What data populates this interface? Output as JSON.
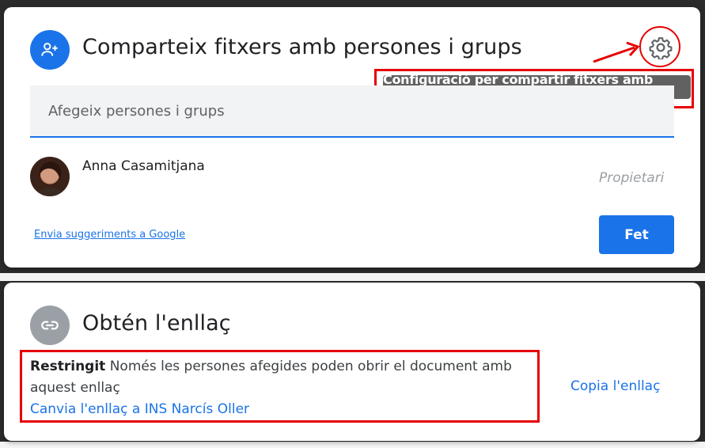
{
  "share_dialog": {
    "title": "Comparteix fitxers amb persones i grups",
    "settings_tooltip": "Configuració per compartir fitxers amb persones",
    "search_placeholder": "Afegeix persones i grups",
    "people": [
      {
        "name": "Anna Casamitjana",
        "role": "Propietari"
      }
    ],
    "feedback_link": "Envia suggeriments a Google",
    "done_button": "Fet"
  },
  "link_dialog": {
    "title": "Obtén l'enllaç",
    "access_level": "Restringit",
    "access_description": "Només les persones afegides poden obrir el document amb aquest enllaç",
    "change_link": "Canvia l'enllaç a INS Narcís Oller",
    "copy_link": "Copia l'enllaç"
  },
  "colors": {
    "accent": "#1a73e8",
    "annotation_red": "#e50000",
    "tooltip_bg": "#616161",
    "link_icon_bg": "#9aa0a6"
  },
  "icons": {
    "share_header": "add-person-icon",
    "settings": "gear-icon",
    "link_header": "link-icon"
  }
}
